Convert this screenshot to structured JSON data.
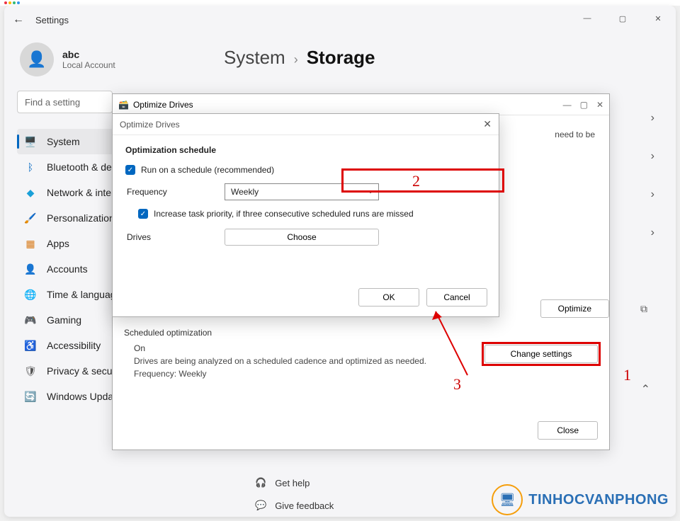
{
  "window": {
    "back_icon": "←",
    "title": "Settings",
    "controls": {
      "min": "—",
      "max": "▢",
      "close": "✕"
    }
  },
  "profile": {
    "name": "abc",
    "account": "Local Account"
  },
  "search": {
    "placeholder": "Find a setting"
  },
  "nav": [
    {
      "icon": "🖥️",
      "label": "System",
      "active": true
    },
    {
      "icon": "ᛒ",
      "label": "Bluetooth & devices",
      "color": "#0067c0"
    },
    {
      "icon": "◆",
      "label": "Network & internet",
      "color": "#1aa0d8"
    },
    {
      "icon": "🖌️",
      "label": "Personalization"
    },
    {
      "icon": "▦",
      "label": "Apps",
      "color": "#d87b1a"
    },
    {
      "icon": "👤",
      "label": "Accounts",
      "color": "#1aa06b"
    },
    {
      "icon": "🌐",
      "label": "Time & language",
      "color": "#1a7fd8"
    },
    {
      "icon": "🎮",
      "label": "Gaming",
      "color": "#888"
    },
    {
      "icon": "♿",
      "label": "Accessibility",
      "color": "#0067c0"
    },
    {
      "icon": "🛡",
      "label": "Privacy & security",
      "color": "#555"
    },
    {
      "icon": "🔄",
      "label": "Windows Update",
      "color": "#1aa0d8"
    }
  ],
  "breadcrumb": {
    "parent": "System",
    "sep": "›",
    "current": "Storage"
  },
  "optimize_outer": {
    "title": "Optimize Drives",
    "body_partial": "need to be",
    "optimize_btn": "Optimize",
    "sched_header": "Scheduled optimization",
    "sched_on": "On",
    "sched_text": "Drives are being analyzed on a scheduled cadence and optimized as needed.",
    "sched_freq": "Frequency: Weekly",
    "change_btn": "Change settings",
    "close_btn": "Close"
  },
  "dialog": {
    "title": "Optimize Drives",
    "section": "Optimization schedule",
    "run_label": "Run on a schedule (recommended)",
    "freq_label": "Frequency",
    "freq_value": "Weekly",
    "inc_label": "Increase task priority, if three consecutive scheduled runs are missed",
    "drives_label": "Drives",
    "choose_btn": "Choose",
    "ok": "OK",
    "cancel": "Cancel",
    "close_x": "✕"
  },
  "annotations": {
    "n1": "1",
    "n2": "2",
    "n3": "3"
  },
  "help": {
    "get": "Get help",
    "fb": "Give feedback"
  },
  "brand": {
    "text": "TINHOCVANPHONG"
  }
}
